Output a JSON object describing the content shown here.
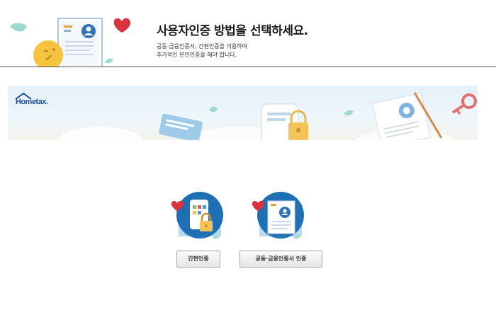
{
  "header": {
    "title": "사용자인증 방법을 선택하세요.",
    "desc_line1": "공동·금융인증서, 간편인증을 이용하여",
    "desc_line2": "추가적인 본인인증을 해야 합니다."
  },
  "banner": {
    "logo_text": "Hometax."
  },
  "options": [
    {
      "label": "간편인증",
      "icon": "simple-auth-phone-lock-icon"
    },
    {
      "label": "공동·금융인증서 인증",
      "icon": "certificate-auth-icon"
    }
  ],
  "colors": {
    "header_line": "#555555",
    "button_border": "#a9a9a9",
    "icon_blue": "#1f6fb4",
    "heart_red": "#d9333f",
    "lock_yellow": "#f2b830"
  }
}
